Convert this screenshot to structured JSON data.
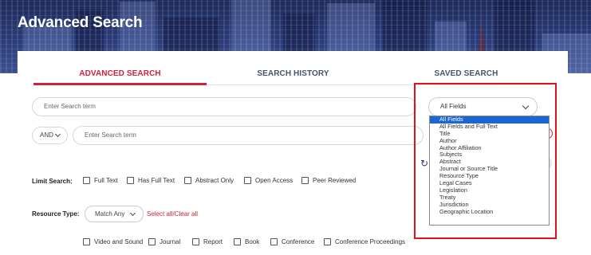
{
  "page": {
    "title": "Advanced Search"
  },
  "tabs": [
    {
      "label": "ADVANCED SEARCH",
      "active": true
    },
    {
      "label": "SEARCH HISTORY",
      "active": false
    },
    {
      "label": "SAVED SEARCH",
      "active": false
    }
  ],
  "search_row1": {
    "placeholder": "Enter Search term",
    "field_value": "All Fields"
  },
  "search_row2": {
    "operator": "AND",
    "placeholder": "Enter Search term"
  },
  "field_options": [
    "All Fields",
    "All Fields and Full Text",
    "Title",
    "Author",
    "Author Affiliation",
    "Subjects",
    "Abstract",
    "Journal or Source Title",
    "Resource Type",
    "Legal Cases",
    "Legislation",
    "Treaty",
    "Jurisdiction",
    "Geographic Location"
  ],
  "field_selected": "All Fields",
  "limit": {
    "label": "Limit Search:",
    "options": [
      "Full Text",
      "Has Full Text",
      "Abstract Only",
      "Open Access",
      "Peer Reviewed"
    ]
  },
  "resource": {
    "label": "Resource Type:",
    "match_value": "Match Any",
    "select_all": "Select all/Clear all",
    "types": [
      "Video and Sound",
      "Journal",
      "Report",
      "Book",
      "Conference",
      "Conference Proceedings"
    ]
  },
  "colors": {
    "accent": "#d21f3c",
    "highlight_border": "#e0131d",
    "selected_option": "#1a66d2"
  }
}
